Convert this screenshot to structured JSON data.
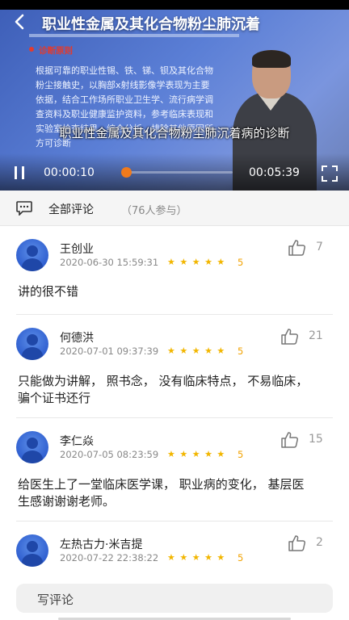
{
  "player": {
    "title": "职业性金属及其化合物粉尘肺沉着",
    "slide_heading": "诊断原则",
    "slide_lines": [
      "根据可靠的职业性锡、铁、锑、钡及其化合物",
      "粉尘接触史，以胸部x射线影像学表现为主要",
      "依据，结合工作场所职业卫生学、流行病学调",
      "查资料及职业健康监护资料，参考临床表现和",
      "实验室检查结果，综合分析，排除其他原因所",
      "方可诊断"
    ],
    "subtitle": "职业性金属及其化合物粉尘肺沉着病的诊断",
    "current_time": "00:00:10",
    "total_time": "00:05:39",
    "progress_fraction": 0.03
  },
  "comments_header": {
    "title": "全部评论",
    "count": "（76人参与）"
  },
  "comments": [
    {
      "name": "王创业",
      "time": "2020-06-30 15:59:31",
      "stars": "★ ★ ★ ★ ★",
      "score": "5",
      "likes": "7",
      "text": "讲的很不错"
    },
    {
      "name": "何德洪",
      "time": "2020-07-01 09:37:39",
      "stars": "★ ★ ★ ★ ★",
      "score": "5",
      "likes": "21",
      "text_lines": [
        "只能做为讲解， 照书念， 没有临床特点， 不易临床，",
        "骗个证书还行"
      ]
    },
    {
      "name": "李仁焱",
      "time": "2020-07-05 08:23:59",
      "stars": "★ ★ ★ ★ ★",
      "score": "5",
      "likes": "15",
      "text_lines": [
        "给医生上了一堂临床医学课， 职业病的变化， 基层医",
        "生感谢谢谢老师。"
      ]
    },
    {
      "name": "左热古力·米吉提",
      "time": "2020-07-22 22:38:22",
      "stars": "★ ★ ★ ★ ★",
      "score": "5",
      "likes": "2"
    }
  ],
  "bottom_bar": {
    "write_label": "写评论"
  },
  "colors": {
    "accent_orange": "#f07a1c",
    "star_gold": "#f2b600",
    "avatar_blue": "#2f5fd0"
  }
}
